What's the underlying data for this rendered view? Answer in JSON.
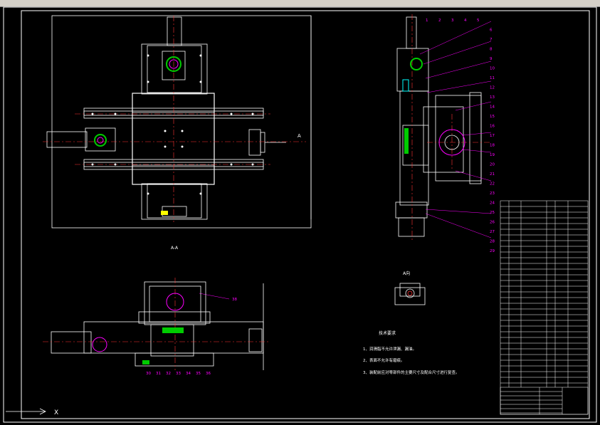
{
  "toolbar": {
    "visible": true
  },
  "view_labels": {
    "section_aa": "A-A",
    "view_a": "A向",
    "arrow_a": "A"
  },
  "tech_requirements": {
    "title": "技术要求",
    "items": [
      "1、润滑脂不允许泄漏、漏油。",
      "2、表面不允许有磨痕。",
      "3、装配前应对零部件的主要尺寸及配合尺寸进行复查。"
    ]
  },
  "balloons_right": [
    "1",
    "2",
    "3",
    "4",
    "5",
    "6",
    "7",
    "8",
    "9",
    "10",
    "11",
    "12",
    "13",
    "14",
    "15",
    "16",
    "17",
    "18",
    "19",
    "20",
    "21",
    "22",
    "23",
    "24",
    "25",
    "26",
    "27",
    "28",
    "29"
  ],
  "balloons_bottom": [
    "30",
    "31",
    "32",
    "33",
    "34",
    "35",
    "36"
  ],
  "balloon_right_callout": "38",
  "coord": {
    "x_label": "X"
  },
  "colors": {
    "background": "#000000",
    "line": "#ffffff",
    "red": "#ff3333",
    "magenta": "#ff00ff",
    "green": "#00cc00",
    "yellow": "#ffff00",
    "cyan": "#00ffff"
  }
}
